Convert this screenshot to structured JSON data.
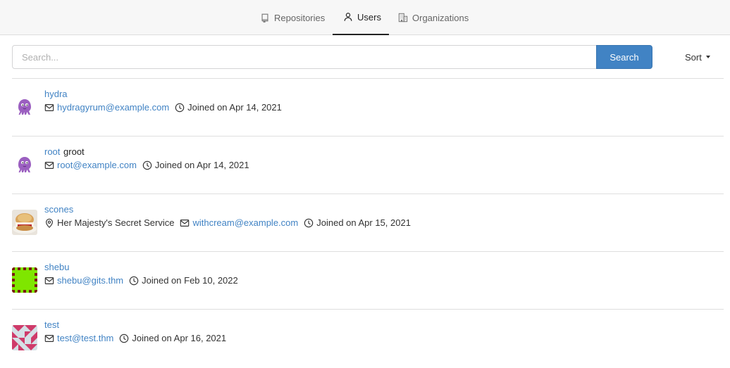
{
  "tabs": {
    "repositories": "Repositories",
    "users": "Users",
    "organizations": "Organizations"
  },
  "search": {
    "placeholder": "Search...",
    "button_label": "Search"
  },
  "sort": {
    "label": "Sort"
  },
  "users": [
    {
      "username": "hydra",
      "full_name": "",
      "location": "",
      "email": "hydragyrum@example.com",
      "joined": "Joined on Apr 14, 2021",
      "avatar": "octopus-avatar"
    },
    {
      "username": "root",
      "full_name": "groot",
      "location": "",
      "email": "root@example.com",
      "joined": "Joined on Apr 14, 2021",
      "avatar": "octopus-avatar"
    },
    {
      "username": "scones",
      "full_name": "",
      "location": "Her Majesty's Secret Service",
      "email": "withcream@example.com",
      "joined": "Joined on Apr 15, 2021",
      "avatar": "scone-photo-avatar"
    },
    {
      "username": "shebu",
      "full_name": "",
      "location": "",
      "email": "shebu@gits.thm",
      "joined": "Joined on Feb 10, 2022",
      "avatar": "green-identicon-avatar"
    },
    {
      "username": "test",
      "full_name": "",
      "location": "",
      "email": "test@test.thm",
      "joined": "Joined on Apr 16, 2021",
      "avatar": "pink-identicon-avatar"
    }
  ],
  "colors": {
    "link": "#4183c4",
    "search_button": "#4183c4",
    "border": "#dedede"
  }
}
